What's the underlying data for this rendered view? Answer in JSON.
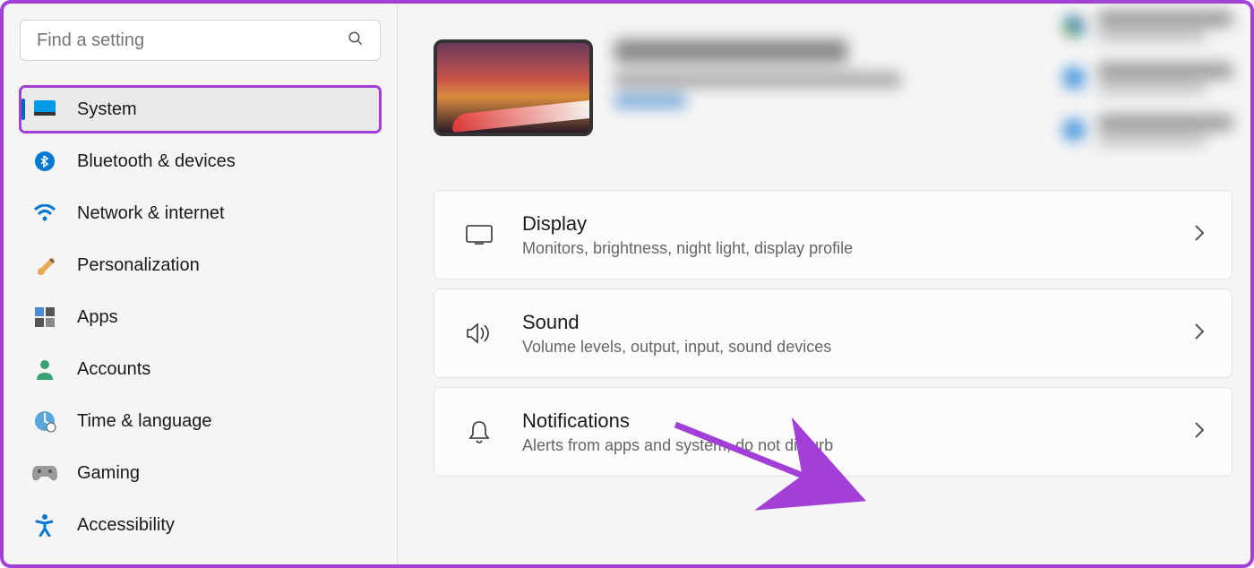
{
  "search": {
    "placeholder": "Find a setting"
  },
  "nav": {
    "items": [
      {
        "id": "system",
        "label": "System",
        "selected": true,
        "highlighted": true
      },
      {
        "id": "bluetooth",
        "label": "Bluetooth & devices"
      },
      {
        "id": "network",
        "label": "Network & internet"
      },
      {
        "id": "personalization",
        "label": "Personalization"
      },
      {
        "id": "apps",
        "label": "Apps"
      },
      {
        "id": "accounts",
        "label": "Accounts"
      },
      {
        "id": "time",
        "label": "Time & language"
      },
      {
        "id": "gaming",
        "label": "Gaming"
      },
      {
        "id": "accessibility",
        "label": "Accessibility"
      }
    ]
  },
  "cards": {
    "display": {
      "title": "Display",
      "sub": "Monitors, brightness, night light, display profile"
    },
    "sound": {
      "title": "Sound",
      "sub": "Volume levels, output, input, sound devices"
    },
    "notifications": {
      "title": "Notifications",
      "sub": "Alerts from apps and system, do not disturb"
    }
  },
  "annotation": {
    "highlight_color": "#a23fd6"
  }
}
